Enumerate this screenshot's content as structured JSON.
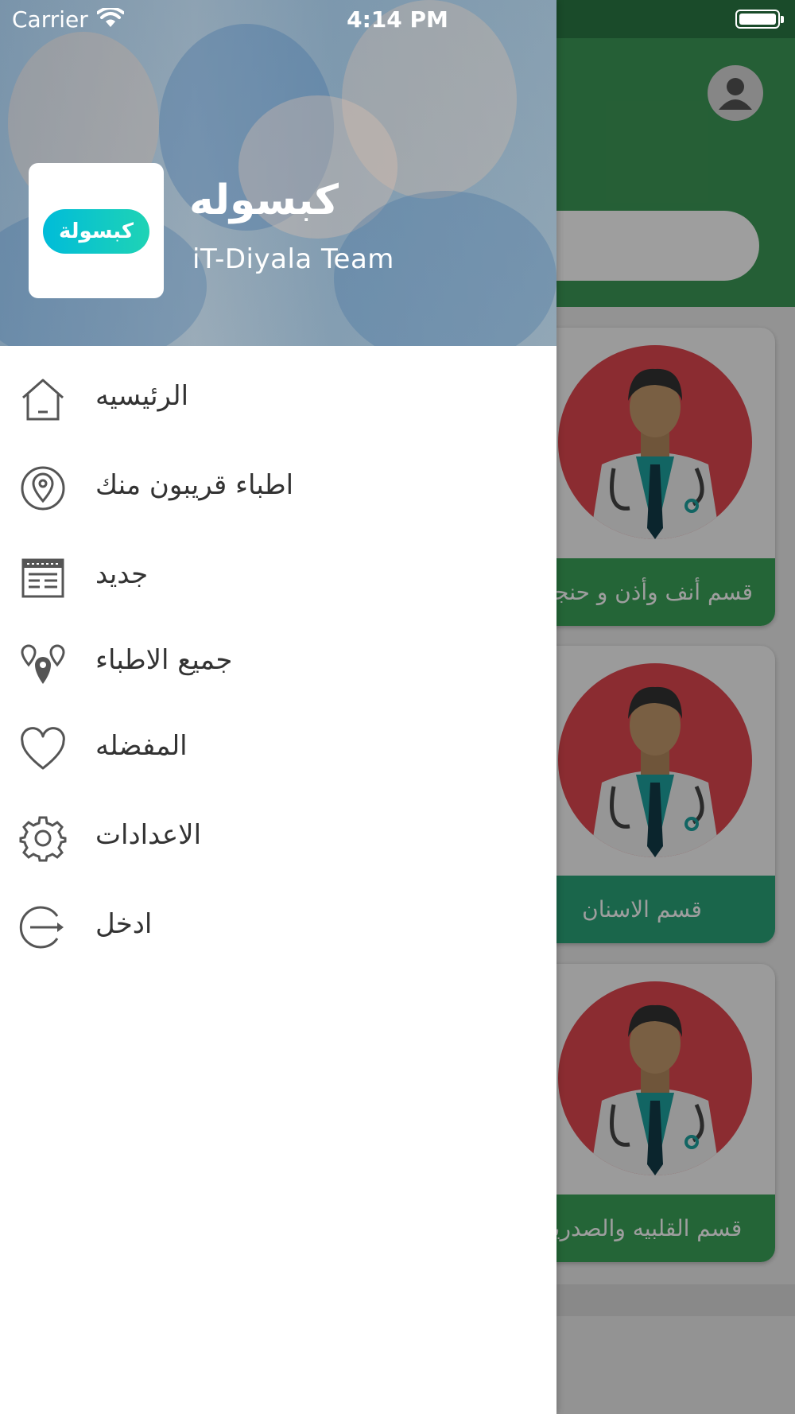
{
  "status_bar": {
    "carrier": "Carrier",
    "time": "4:14 PM"
  },
  "drawer": {
    "app_name": "كبسوله",
    "team": "iT-Diyala Team",
    "logo_text": "كبسولة",
    "menu": [
      {
        "label": "الرئيسيه",
        "icon": "home-icon"
      },
      {
        "label": "اطباء قريبون منك",
        "icon": "location-pin-icon"
      },
      {
        "label": "جديد",
        "icon": "news-icon"
      },
      {
        "label": "جميع الاطباء",
        "icon": "multiple-locations-icon"
      },
      {
        "label": "المفضله",
        "icon": "heart-icon"
      },
      {
        "label": "الاعدادات",
        "icon": "gear-icon"
      },
      {
        "label": "ادخل",
        "icon": "login-icon"
      }
    ]
  },
  "background": {
    "sections": [
      {
        "label": "قسم أنف وأذن و حنجرة",
        "color": "#3aa35a"
      },
      {
        "label": "قسم الاسنان",
        "color": "#2aa57a"
      },
      {
        "label": "قسم القلبيه والصدريه",
        "color": "#3aa35a"
      }
    ]
  },
  "colors": {
    "header_green": "#3d9a57",
    "logo_gradient_start": "#00bcd9",
    "logo_gradient_end": "#1fd3b5"
  }
}
